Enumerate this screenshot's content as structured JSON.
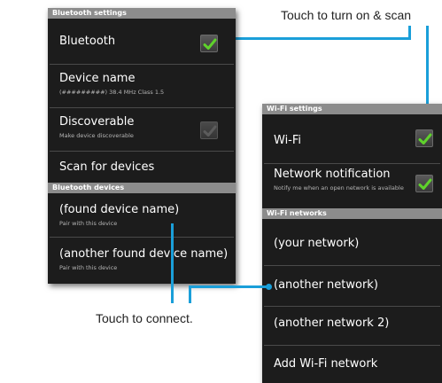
{
  "callouts": {
    "scan": "Touch to turn on & scan",
    "connect": "Touch to connect."
  },
  "bluetooth_screen": {
    "settings_header": "Bluetooth settings",
    "bluetooth_label": "Bluetooth",
    "bluetooth_checked": true,
    "device_name_label": "Device name",
    "device_name_value": "(#########) 38.4 MHz Class 1.5",
    "discoverable_label": "Discoverable",
    "discoverable_sub": "Make device discoverable",
    "discoverable_checked": false,
    "scan_label": "Scan for devices",
    "devices_header": "Bluetooth devices",
    "devices": [
      {
        "name": "(found device name)",
        "sub": "Pair with this device"
      },
      {
        "name": "(another found device name)",
        "sub": "Pair with this device"
      }
    ]
  },
  "wifi_screen": {
    "settings_header": "Wi-Fi settings",
    "wifi_label": "Wi-Fi",
    "wifi_checked": true,
    "notification_label": "Network notification",
    "notification_sub": "Notify me when an open network is available",
    "notification_checked": true,
    "networks_header": "Wi-Fi networks",
    "networks": [
      "(your network)",
      "(another network)",
      "(another network 2)"
    ],
    "add_network_label": "Add Wi-Fi network"
  },
  "colors": {
    "callout_line": "#1a9fd9",
    "check_green": "#5fd22b",
    "panel_bg": "#1c1c1c",
    "header_bg": "#8c8c8c"
  }
}
